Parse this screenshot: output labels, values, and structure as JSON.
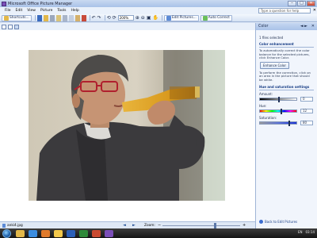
{
  "window": {
    "title": "Microsoft Office Picture Manager",
    "min": "–",
    "max": "□",
    "close": "✕"
  },
  "menu": {
    "items": [
      "File",
      "Edit",
      "View",
      "Picture",
      "Tools",
      "Help"
    ],
    "help_placeholder": "Type a question for help",
    "help_close": "✕"
  },
  "toolbar": {
    "shortcuts": "Shortcuts...",
    "zoom": "200%",
    "edit_pictures": "Edit Pictures...",
    "auto_correct": "Auto Correct"
  },
  "status": {
    "filename": "anki4.jpg",
    "prev": "◄",
    "next": "►",
    "zoom_label": "Zoom:",
    "zoom_minus": "−",
    "zoom_plus": "+"
  },
  "taskpane": {
    "title": "Color",
    "close": "✕",
    "nav": "◄ ►",
    "files_selected": "1 files selected",
    "enhancement_heading": "Color enhancement",
    "enhancement_text": "To automatically correct the color balance for the selected pictures, click Enhance Color.",
    "enhance_button": "Enhance Color",
    "perform_text": "To perform the correction, click on an area in the picture that should be white.",
    "hue_sat_heading": "Hue and saturation settings",
    "amount_label": "Amount:",
    "amount_value": "0",
    "hue_label": "Hue:",
    "hue_value": "12",
    "saturation_label": "Saturation:",
    "saturation_value": "80",
    "back_link": "Back to Edit Pictures"
  },
  "taskbar": {
    "tray_lang": "EN",
    "tray_time": "03:14"
  }
}
